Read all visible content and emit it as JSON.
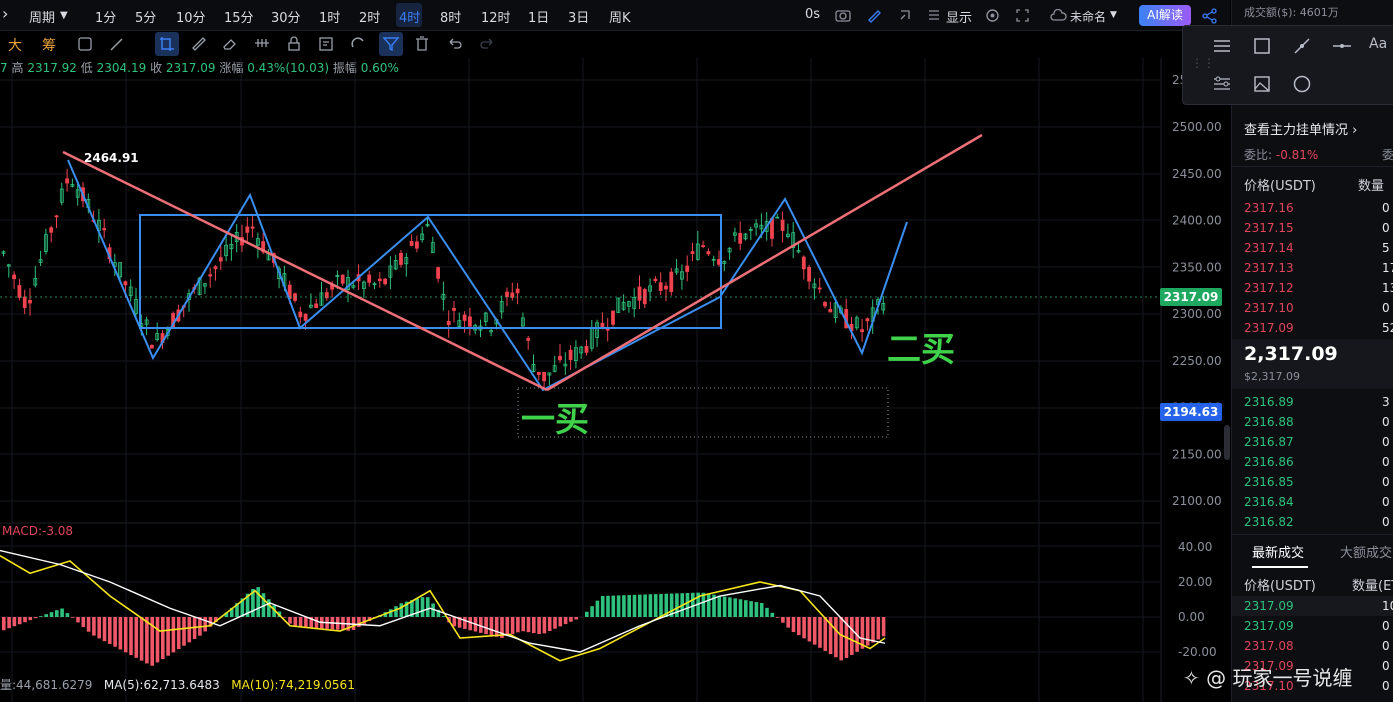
{
  "toolbar": {
    "period_label": "周期",
    "timeframes": [
      "1分",
      "5分",
      "10分",
      "15分",
      "30分",
      "1时",
      "2时",
      "4时",
      "8时",
      "12时",
      "1日",
      "3日",
      "周K"
    ],
    "active_timeframe": "4时",
    "time_display": "0s",
    "display_label": "显示",
    "layout_name": "未命名",
    "ai_button": "AI解读",
    "drawing_prefix": [
      "大",
      "筹"
    ]
  },
  "ohlc": {
    "open_fragment": "7",
    "high_label": "高",
    "high": "2317.92",
    "low_label": "低",
    "low": "2304.19",
    "close_label": "收",
    "close": "2317.09",
    "change_label": "涨幅",
    "change": "0.43%(10.03)",
    "amplitude_label": "振幅",
    "amplitude": "0.60%"
  },
  "annotations": {
    "high_marker": "2464.91",
    "buy1": "一买",
    "buy2": "二买"
  },
  "price_axis": {
    "ticks": [
      "2500.00",
      "2450.00",
      "2400.00",
      "2350.00",
      "2300.00",
      "2250.00",
      "2200.00",
      "2150.00",
      "2100.00"
    ],
    "partial_top": "25",
    "current_price": "2317.09",
    "current_color": "#1fa85f",
    "marker_price": "2194.63",
    "marker_color": "#2563eb"
  },
  "macd": {
    "label": "MACD:-3.08",
    "ticks": [
      "40.00",
      "20.00",
      "0.00",
      "-20.00"
    ]
  },
  "volume": {
    "vol_fragment": "量:44,681.6279",
    "ma5": "MA(5):62,713.6483",
    "ma10": "MA(10):74,219.0561"
  },
  "right_panel": {
    "turnover": "成交额($):  4601万",
    "orderbook_link": "查看主力挂单情况",
    "ratio_label": "委比:",
    "ratio_value": "-0.81%",
    "ratio_fragment": "委",
    "price_header": "价格(USDT)",
    "qty_header": "数量",
    "asks": [
      {
        "price": "2317.16",
        "qty": "0"
      },
      {
        "price": "2317.15",
        "qty": "0"
      },
      {
        "price": "2317.14",
        "qty": "5"
      },
      {
        "price": "2317.13",
        "qty": "17"
      },
      {
        "price": "2317.12",
        "qty": "13"
      },
      {
        "price": "2317.10",
        "qty": "0"
      },
      {
        "price": "2317.09",
        "qty": "52"
      }
    ],
    "last_price": "2,317.09",
    "last_price_usd": "$2,317.09",
    "bids": [
      {
        "price": "2316.89",
        "qty": "3"
      },
      {
        "price": "2316.88",
        "qty": "0"
      },
      {
        "price": "2316.87",
        "qty": "0"
      },
      {
        "price": "2316.86",
        "qty": "0"
      },
      {
        "price": "2316.85",
        "qty": "0"
      },
      {
        "price": "2316.84",
        "qty": "0"
      },
      {
        "price": "2316.82",
        "qty": "0"
      }
    ],
    "tab_latest": "最新成交",
    "tab_large": "大额成交",
    "trades_price_header": "价格(USDT)",
    "trades_qty_header": "数量(ET",
    "trades": [
      {
        "price": "2317.09",
        "qty": "10",
        "side": "buy"
      },
      {
        "price": "2317.09",
        "qty": "0",
        "side": "buy"
      },
      {
        "price": "2317.08",
        "qty": "0",
        "side": "sell"
      },
      {
        "price": "2317.09",
        "qty": "0",
        "side": "sell"
      },
      {
        "price": "2317.10",
        "qty": "0",
        "side": "sell"
      }
    ]
  },
  "watermark": "玩家一号说缠"
}
